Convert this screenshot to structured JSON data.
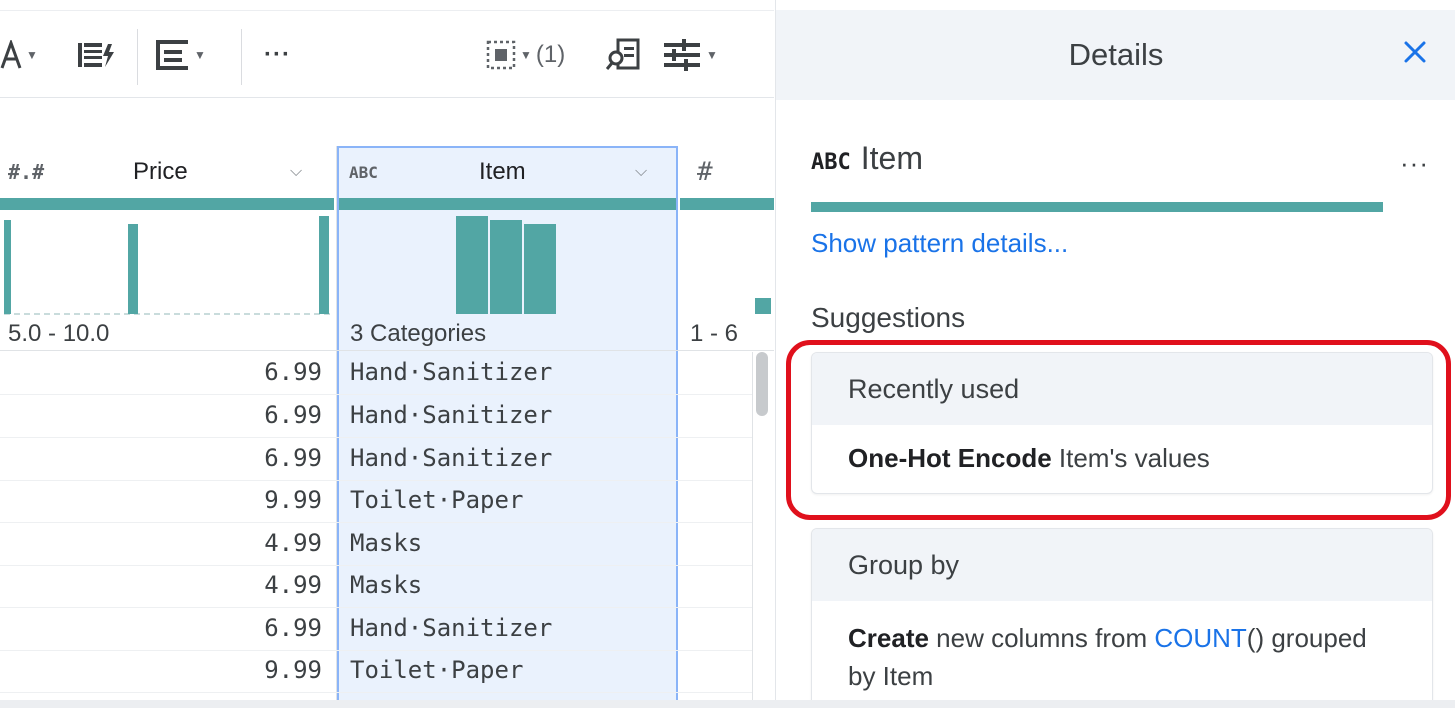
{
  "toolbar": {
    "items": [
      {
        "name": "text-format-icon",
        "caret": true
      },
      {
        "name": "column-action-icon",
        "caret": false
      },
      {
        "name": "row-layout-icon",
        "caret": true
      },
      {
        "name": "more-icon",
        "label": "···"
      }
    ],
    "select_count": "(1)",
    "right_icons": [
      "select-all-icon",
      "find-icon",
      "settings-sliders-icon"
    ]
  },
  "grid": {
    "columns": [
      {
        "type_icon": "#.#",
        "name": "Price",
        "range": "5.0 - 10.0"
      },
      {
        "type_icon": "ABC",
        "name": "Item",
        "range": "3 Categories"
      },
      {
        "type_icon": "#",
        "name": "",
        "range": "1 - 6"
      }
    ],
    "rows": [
      {
        "price": "6.99",
        "item": "Hand·Sanitizer"
      },
      {
        "price": "6.99",
        "item": "Hand·Sanitizer"
      },
      {
        "price": "6.99",
        "item": "Hand·Sanitizer"
      },
      {
        "price": "9.99",
        "item": "Toilet·Paper"
      },
      {
        "price": "4.99",
        "item": "Masks"
      },
      {
        "price": "4.99",
        "item": "Masks"
      },
      {
        "price": "6.99",
        "item": "Hand·Sanitizer"
      },
      {
        "price": "9.99",
        "item": "Toilet·Paper"
      }
    ]
  },
  "details": {
    "title": "Details",
    "close_icon": "close-icon",
    "column_type": "ABC",
    "column_name": "Item",
    "more_label": "···",
    "pattern_link": "Show pattern details...",
    "suggestions_title": "Suggestions",
    "recent": {
      "title": "Recently used",
      "action_bold": "One-Hot Encode",
      "action_rest": " Item's values"
    },
    "group_by": {
      "title": "Group by",
      "line1_bold": "Create",
      "line1_text": " new columns from ",
      "line1_keyword": "COUNT",
      "line1_tail": "() grouped",
      "line2": "by Item"
    }
  },
  "colors": {
    "accent_teal": "#52a6a4",
    "link_blue": "#1a73e8",
    "highlight_red": "#e0101c",
    "selected_column_bg": "#eaf2fd"
  }
}
